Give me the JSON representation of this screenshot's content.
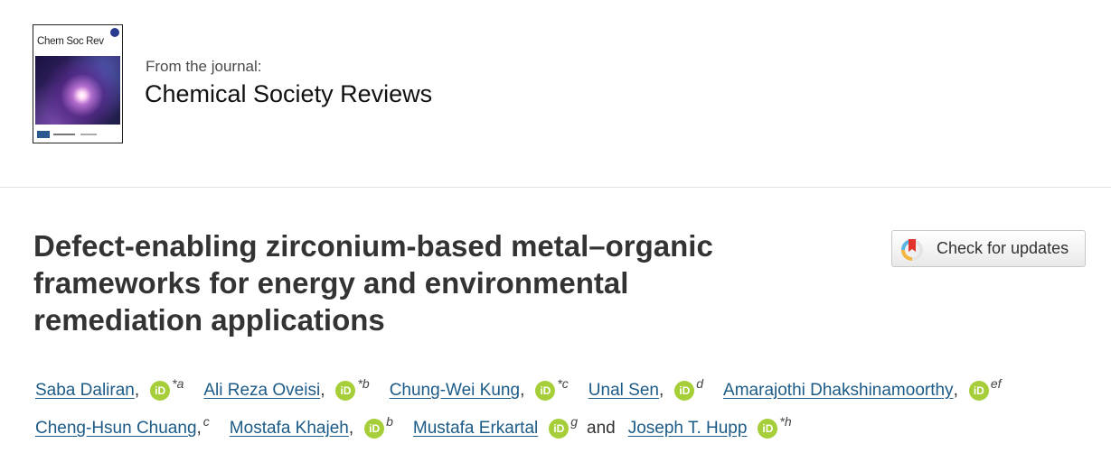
{
  "journal": {
    "cover_title": "Chem Soc Rev",
    "from_label": "From the journal:",
    "name": "Chemical Society Reviews"
  },
  "article": {
    "title_lines": [
      "Defect-enabling zirconium-based metal–organic",
      "frameworks for energy and environmental",
      "remediation applications"
    ]
  },
  "check_updates": {
    "label": "Check for updates"
  },
  "authors": {
    "line1": [
      {
        "name": "Saba Daliran",
        "comma": ",",
        "orcid": true,
        "affil": "*a"
      },
      {
        "name": "Ali Reza Oveisi",
        "comma": ",",
        "orcid": true,
        "affil": "*b"
      },
      {
        "name": "Chung-Wei Kung",
        "comma": ",",
        "orcid": true,
        "affil": "*c"
      },
      {
        "name": "Unal Sen",
        "comma": ",",
        "orcid": true,
        "affil": "d"
      },
      {
        "name": "Amarajothi Dhakshinamoorthy",
        "comma": ",",
        "orcid": true,
        "affil": "ef"
      }
    ],
    "line2": [
      {
        "name": "Cheng-Hsun Chuang",
        "comma": ",",
        "orcid": false,
        "affil": "c"
      },
      {
        "name": "Mostafa Khajeh",
        "comma": ",",
        "orcid": true,
        "affil": "b"
      },
      {
        "name": "Mustafa Erkartal",
        "comma": "",
        "orcid": true,
        "affil": "g"
      },
      {
        "name": "Joseph T. Hupp",
        "comma": "",
        "orcid": true,
        "affil": "*h"
      }
    ],
    "and_word": "and",
    "orcid_text": "iD"
  },
  "colors": {
    "link": "#1c5b87",
    "orcid": "#a6ce39",
    "title": "#333333"
  }
}
